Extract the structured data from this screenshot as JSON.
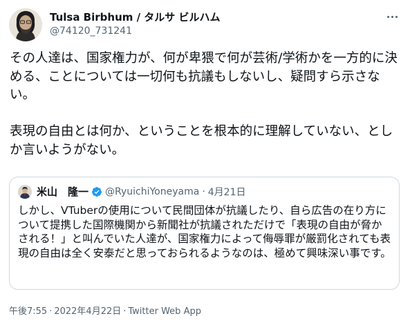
{
  "author": {
    "display_name": "Tulsa Birbhum / タルサ ビルハム",
    "handle": "@74120_731241"
  },
  "tweet": {
    "paragraphs": [
      "その人達は、国家権力が、何が卑猥で何が芸術/学術かを一方的に決める、ことについては一切何も抗議もしないし、疑問すら示さない。",
      "表現の自由とは何か、ということを根本的に理解していない、としか言いようがない。"
    ]
  },
  "quote": {
    "name": "米山　隆一",
    "handle": "@RyuichiYoneyama",
    "separator": "·",
    "date": "4月21日",
    "text": "しかし、VTuberの使用について民間団体が抗議したり、自ら広告の在り方について提携した国際機関から新聞社が抗議されただけで「表現の自由が脅かされる！」と叫んでいた人達が、国家権力によって侮辱罪が厳罰化されても表現の自由は全く安泰だと思っておられるようなのは、極めて興味深い事です。",
    "verified_color": "#1d9bf0"
  },
  "meta": {
    "time": "午後7:55",
    "dot1": "·",
    "date": "2022年4月22日",
    "dot2": "·",
    "source": "Twitter Web App"
  },
  "icons": {
    "more": "more-horizontal-icon",
    "verified": "verified-badge-icon"
  }
}
